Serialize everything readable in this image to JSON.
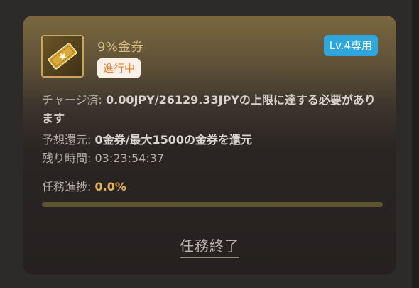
{
  "coupon": {
    "title": "9%金券",
    "status": "進行中",
    "level": "Lv.4専用",
    "icon": "gold-ticket-icon"
  },
  "details": {
    "charge_label": "チャージ済:",
    "charge_value": "0.00JPY/26129.33JPYの上限に達する必要があります",
    "expected_label": "予想還元:",
    "expected_value": "0金券/最大1500の金券を還元",
    "remain_label": "残り時間:",
    "remain_value": "03:23:54:37",
    "progress_label": "任務進捗:",
    "progress_value": "0.0%",
    "progress_fraction": 0.0
  },
  "actions": {
    "end_label": "任務終了"
  },
  "colors": {
    "accent_gold": "#e0b35b",
    "badge_blue": "#2fa6dc",
    "status_orange": "#ed7c2c"
  }
}
